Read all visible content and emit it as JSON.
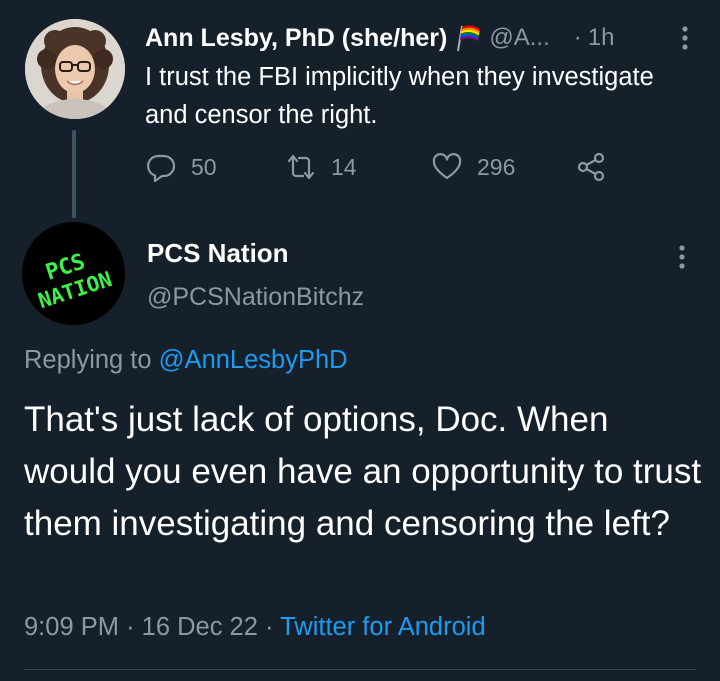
{
  "parent_tweet": {
    "author_name": "Ann Lesby, PhD (she/her)",
    "author_handle": "@A...",
    "separator": "·",
    "time_ago": "1h",
    "text": "I trust the FBI implicitly when they investigate and censor the right.",
    "replies": "50",
    "retweets": "14",
    "likes": "296",
    "icons": [
      "rainbow-flag-icon",
      "more-vertical-icon",
      "reply-icon",
      "retweet-icon",
      "like-icon",
      "share-icon"
    ]
  },
  "main_tweet": {
    "avatar_text": "PCS NATION",
    "author_name": "PCS Nation",
    "author_handle": "@PCSNationBitchz",
    "replying_prefix": "Replying to",
    "replying_to": "@AnnLesbyPhD",
    "text": "That's just lack of options, Doc. When would you even have an opportunity to trust them investigating and censoring the left?",
    "time": "9:09 PM",
    "date": "16 Dec 22",
    "separator": "·",
    "source": "Twitter for Android"
  },
  "colors": {
    "background": "#15202b",
    "text_primary": "#ffffff",
    "text_secondary": "#8b98a5",
    "link": "#1d9bf0",
    "avatar_green": "#3ef04a"
  }
}
